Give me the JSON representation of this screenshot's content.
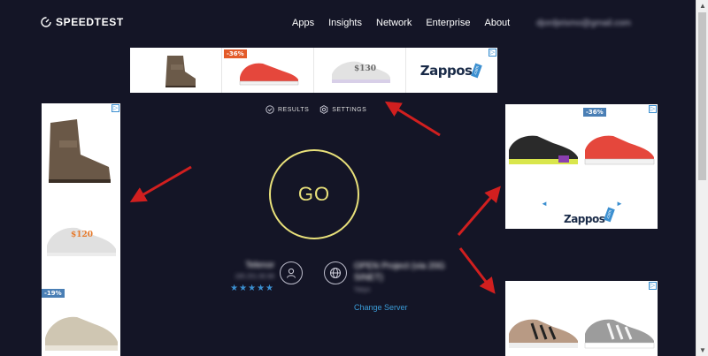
{
  "header": {
    "logo_text": "SPEEDTEST",
    "nav": [
      "Apps",
      "Insights",
      "Network",
      "Enterprise",
      "About"
    ],
    "user_email": "djordjeismo@gmail.com"
  },
  "top_ad": {
    "discount": "-36%",
    "price": "$130",
    "brand": "Zappos",
    "brand_suffix": ".com"
  },
  "left_ad": {
    "price": "$120",
    "discount": "-19%"
  },
  "right_ad_1": {
    "discount": "-36%",
    "brand": "Zappos",
    "brand_suffix": ".com",
    "prev": "◄",
    "next": "►"
  },
  "main": {
    "results_label": "RESULTS",
    "settings_label": "SETTINGS",
    "go_label": "GO",
    "isp_name": "Telenor",
    "isp_ip": "185.251.90.98",
    "rating_stars": "★★★★★",
    "server_name": "OPEN Project (via 20G SINET)",
    "server_location": "Tokyo",
    "change_server_label": "Change Server"
  },
  "colors": {
    "background": "#141526",
    "go_ring": "#e8e07a",
    "link": "#3b9cd8",
    "arrow": "#d11f1f"
  }
}
